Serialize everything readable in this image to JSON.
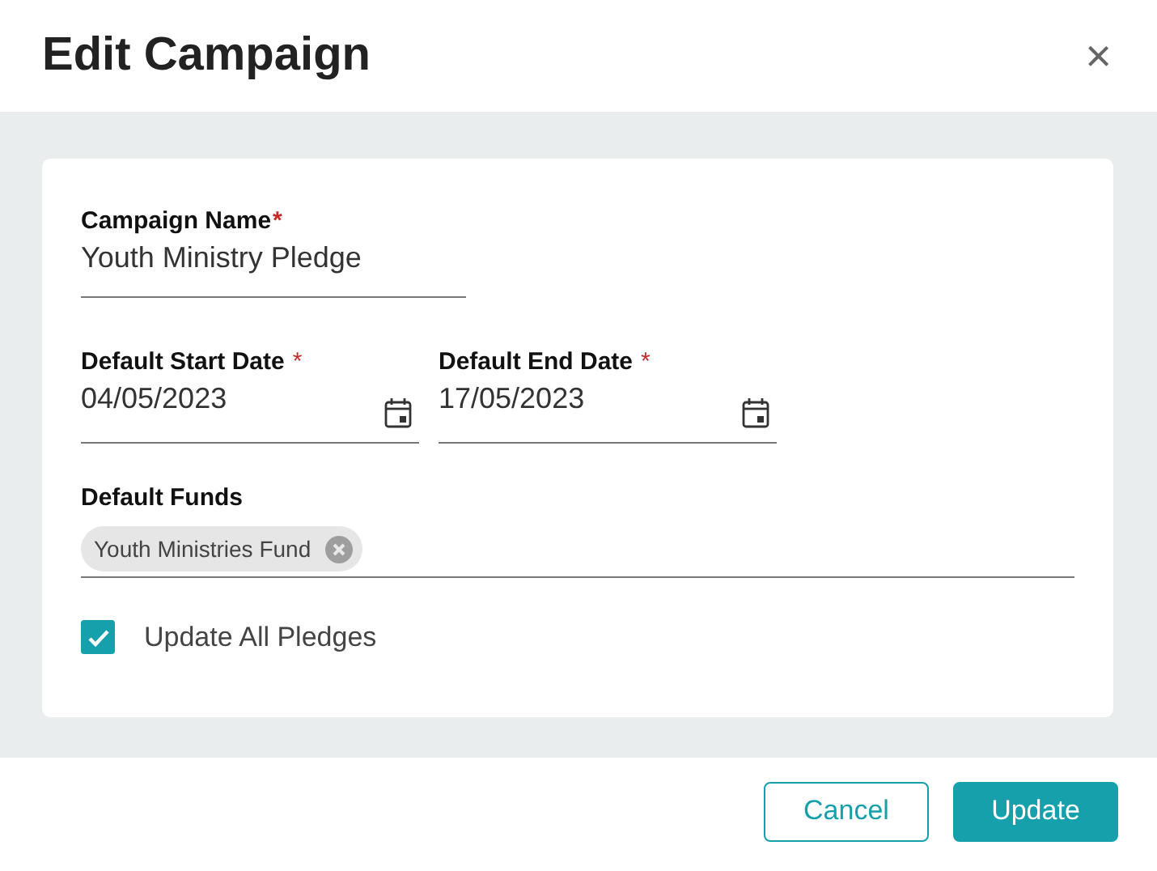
{
  "dialog": {
    "title": "Edit Campaign",
    "close": "×"
  },
  "campaign_name": {
    "label": "Campaign Name",
    "required_mark": "*",
    "value": "Youth Ministry Pledge"
  },
  "dates": [
    {
      "label": "Default Start Date",
      "required_mark": "*",
      "value": "04/05/2023"
    },
    {
      "label": "Default End Date",
      "required_mark": "*",
      "value": "17/05/2023"
    }
  ],
  "funds": {
    "label": "Default Funds",
    "chips": [
      "Youth Ministries Fund"
    ]
  },
  "update_all": {
    "label": "Update All Pledges",
    "checked": true
  },
  "buttons": [
    {
      "label": "Cancel",
      "kind": "secondary"
    },
    {
      "label": "Update",
      "kind": "primary"
    }
  ]
}
